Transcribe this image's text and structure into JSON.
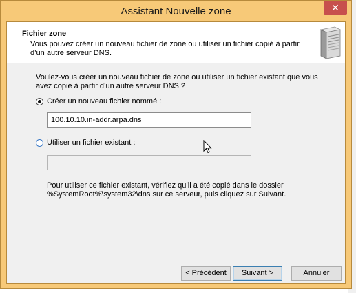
{
  "window": {
    "title": "Assistant Nouvelle zone",
    "close_glyph": "✕"
  },
  "header": {
    "title": "Fichier zone",
    "description": "Vous pouvez créer un nouveau fichier de zone ou utiliser un fichier copié à partir d’un autre serveur DNS.",
    "icon": "server-icon"
  },
  "content": {
    "question": "Voulez-vous créer un nouveau fichier de zone ou utiliser un fichier existant que vous avez copié à partir d’un autre serveur DNS ?",
    "option_new": {
      "label": "Créer un nouveau fichier nommé :",
      "selected": true
    },
    "new_file_value": "100.10.10.in-addr.arpa.dns",
    "option_existing": {
      "label": "Utiliser un fichier existant :",
      "selected": false
    },
    "existing_file_value": "",
    "note": "Pour utiliser ce fichier existant, vérifiez qu’il a été copié dans le dossier %SystemRoot%\\system32\\dns sur ce serveur, puis cliquez sur Suivant."
  },
  "buttons": {
    "back": "< Précédent",
    "next": "Suivant >",
    "cancel": "Annuler"
  },
  "colors": {
    "title_bar": "#f7c978",
    "close_button": "#c7504d",
    "client_bg": "#f0f0f0"
  }
}
